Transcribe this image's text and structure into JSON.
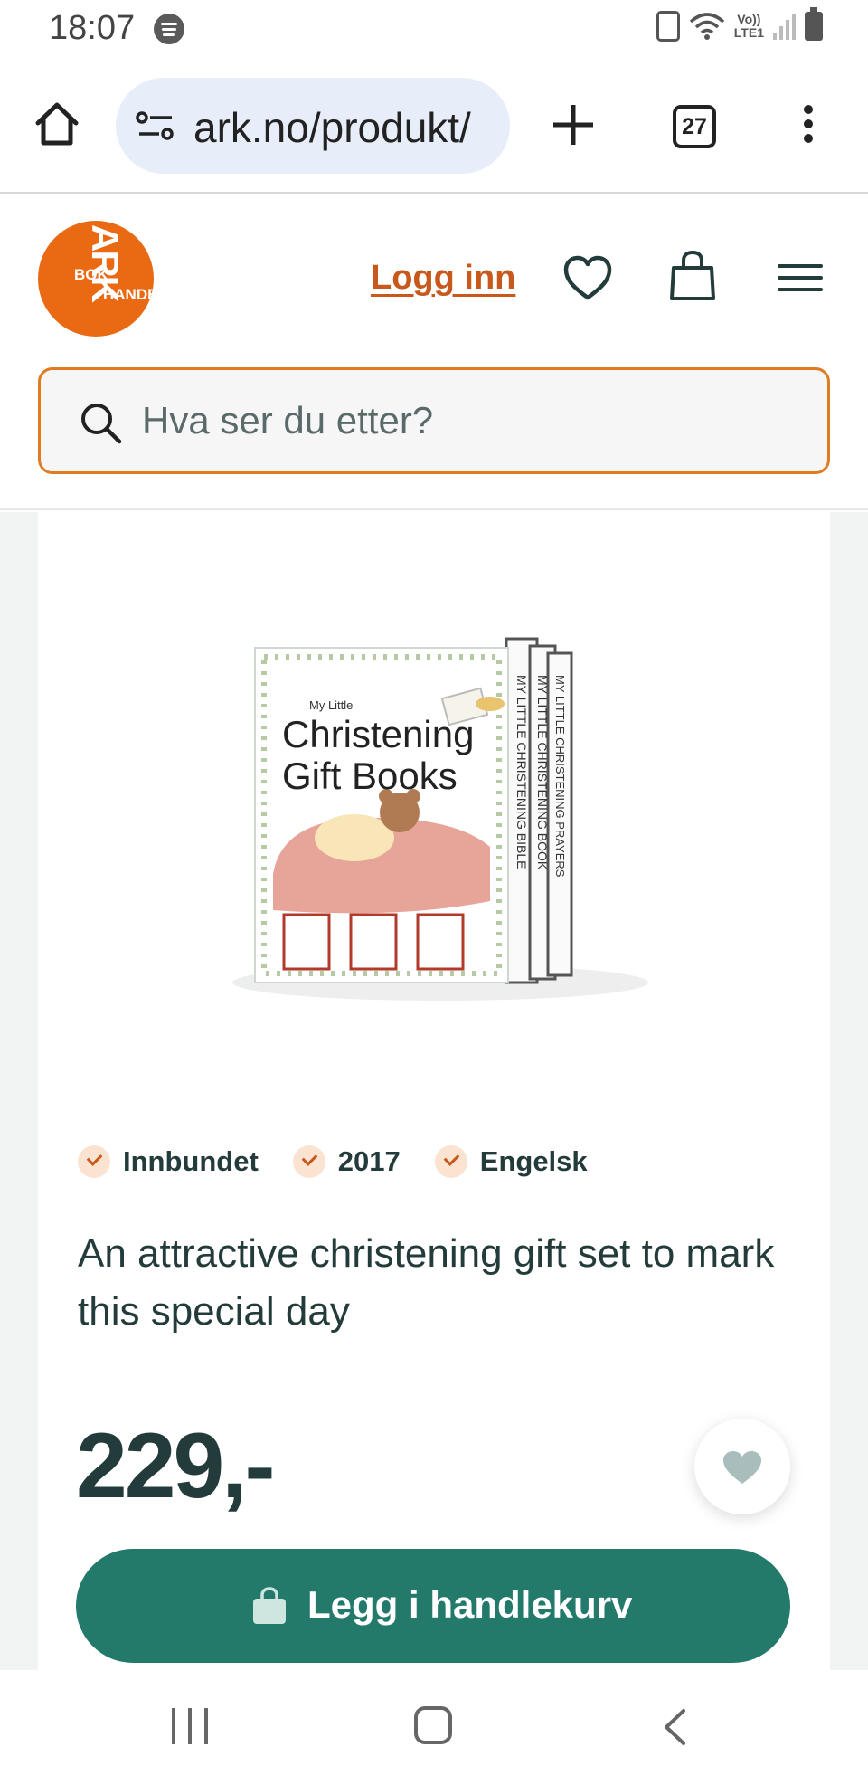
{
  "status_bar": {
    "time": "18:07",
    "network_label_top": "Vo))",
    "network_label_bottom": "LTE1",
    "icons": [
      "spotify-icon",
      "nfc-icon",
      "wifi-icon",
      "signal-icon",
      "battery-icon"
    ]
  },
  "browser": {
    "url": "ark.no/produkt/",
    "tab_count": "27",
    "icons": [
      "home-icon",
      "site-settings-icon",
      "new-tab-icon",
      "tabs-icon",
      "more-vert-icon"
    ]
  },
  "header": {
    "logo_text_main": "ARK",
    "logo_text_left": "BOK",
    "logo_text_right": "HANDEL",
    "login_label": "Logg inn",
    "icons": [
      "heart-icon",
      "shopping-bag-icon",
      "hamburger-menu-icon"
    ]
  },
  "search": {
    "placeholder": "Hva ser du etter?",
    "value": ""
  },
  "product": {
    "image_alt": "My Little Christening Gift Books",
    "cover_title_small": "My Little",
    "cover_title_line1": "Christening",
    "cover_title_line2": "Gift Books",
    "spine_1": "MY LITTLE CHRISTENING BIBLE",
    "spine_2": "MY LITTLE CHRISTENING BOOK",
    "spine_3": "MY LITTLE CHRISTENING PRAYERS",
    "meta": [
      {
        "label": "Innbundet"
      },
      {
        "label": "2017"
      },
      {
        "label": "Engelsk"
      }
    ],
    "tagline": "An attractive christening gift set to mark this special day",
    "price": "229,-",
    "add_to_cart_label": "Legg i handlekurv"
  },
  "colors": {
    "brand_orange": "#ea6a13",
    "link_orange": "#c8581b",
    "cart_green": "#237a6b",
    "text_dark": "#243b3b"
  },
  "navbar": {
    "icons": [
      "recent-apps-icon",
      "home-button-icon",
      "back-icon"
    ]
  }
}
